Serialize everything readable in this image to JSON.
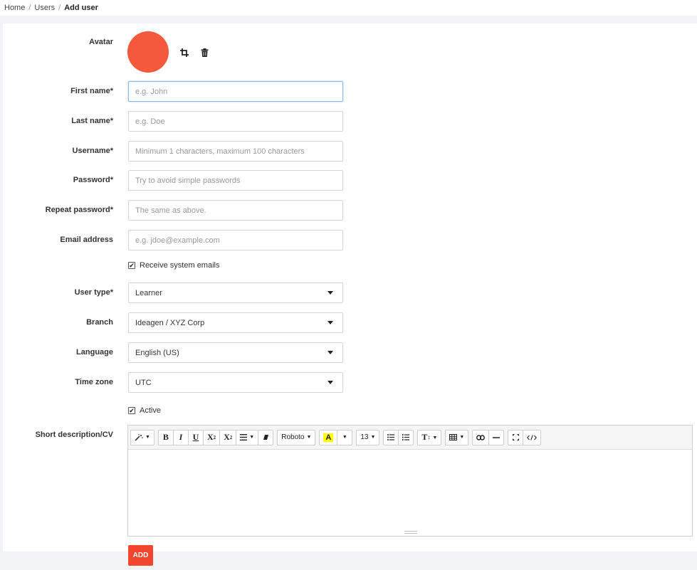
{
  "breadcrumb": {
    "home": "Home",
    "users": "Users",
    "current": "Add user",
    "sep": "/"
  },
  "avatar": {
    "label": "Avatar",
    "color": "#f35a3b"
  },
  "fields": {
    "first_name": {
      "label": "First name*",
      "placeholder": "e.g. John"
    },
    "last_name": {
      "label": "Last name*",
      "placeholder": "e.g. Doe"
    },
    "username": {
      "label": "Username*",
      "placeholder": "Minimum 1 characters, maximum 100 characters"
    },
    "password": {
      "label": "Password*",
      "placeholder": "Try to avoid simple passwords"
    },
    "repeat_password": {
      "label": "Repeat password*",
      "placeholder": "The same as above."
    },
    "email": {
      "label": "Email address",
      "placeholder": "e.g. jdoe@example.com"
    }
  },
  "receive_emails": {
    "label": "Receive system emails",
    "checked": true
  },
  "selects": {
    "user_type": {
      "label": "User type*",
      "value": "Learner"
    },
    "branch": {
      "label": "Branch",
      "value": "Ideagen / XYZ Corp"
    },
    "language": {
      "label": "Language",
      "value": "English (US)"
    },
    "time_zone": {
      "label": "Time zone",
      "value": "UTC"
    }
  },
  "active": {
    "label": "Active",
    "checked": true
  },
  "description": {
    "label": "Short description/CV",
    "toolbar": {
      "bold": "B",
      "italic": "I",
      "underline": "U",
      "superscript": "X",
      "subscript": "X",
      "font": "Roboto",
      "highlight": "A",
      "font_size": "13",
      "text_style": "T"
    }
  },
  "submit": {
    "label": "ADD",
    "color": "#f2462e"
  }
}
